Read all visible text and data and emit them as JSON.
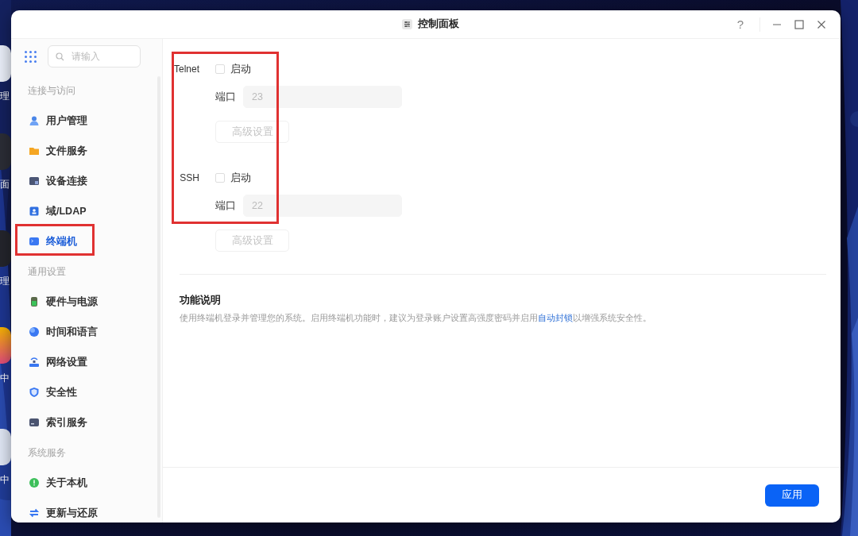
{
  "desktop_icons": [
    {
      "label": "理"
    },
    {
      "label": "面"
    },
    {
      "label": "理"
    },
    {
      "label": "中"
    },
    {
      "label": "中"
    }
  ],
  "window": {
    "title": "控制面板",
    "help": "?"
  },
  "sidebar": {
    "search": {
      "placeholder": "请输入"
    },
    "sections": [
      {
        "title": "连接与访问",
        "items": [
          {
            "label": "用户管理",
            "selected": false,
            "highlighted": false
          },
          {
            "label": "文件服务",
            "selected": false,
            "highlighted": false
          },
          {
            "label": "设备连接",
            "selected": false,
            "highlighted": false
          },
          {
            "label": "域/LDAP",
            "selected": false,
            "highlighted": false
          },
          {
            "label": "终端机",
            "selected": true,
            "highlighted": true
          }
        ]
      },
      {
        "title": "通用设置",
        "items": [
          {
            "label": "硬件与电源",
            "selected": false,
            "highlighted": false
          },
          {
            "label": "时间和语言",
            "selected": false,
            "highlighted": false
          },
          {
            "label": "网络设置",
            "selected": false,
            "highlighted": false
          },
          {
            "label": "安全性",
            "selected": false,
            "highlighted": false
          },
          {
            "label": "索引服务",
            "selected": false,
            "highlighted": false
          }
        ]
      },
      {
        "title": "系统服务",
        "items": [
          {
            "label": "关于本机",
            "selected": false,
            "highlighted": false
          },
          {
            "label": "更新与还原",
            "selected": false,
            "highlighted": false
          }
        ]
      }
    ]
  },
  "services_highlighted": true,
  "services": [
    {
      "name": "Telnet",
      "enable_label": "启动",
      "checked": false,
      "port_label": "端口",
      "port": "23",
      "disabled": true,
      "advanced_label": "高级设置"
    },
    {
      "name": "SSH",
      "enable_label": "启动",
      "checked": false,
      "port_label": "端口",
      "port": "22",
      "disabled": true,
      "advanced_label": "高级设置"
    }
  ],
  "description": {
    "title": "功能说明",
    "text": "使用终端机登录并管理您的系统。启用终端机功能时，建议为登录账户设置高强度密码并启用",
    "link": "自动封锁",
    "text_after": "以增强系统安全性。"
  },
  "apply_button": "应用"
}
